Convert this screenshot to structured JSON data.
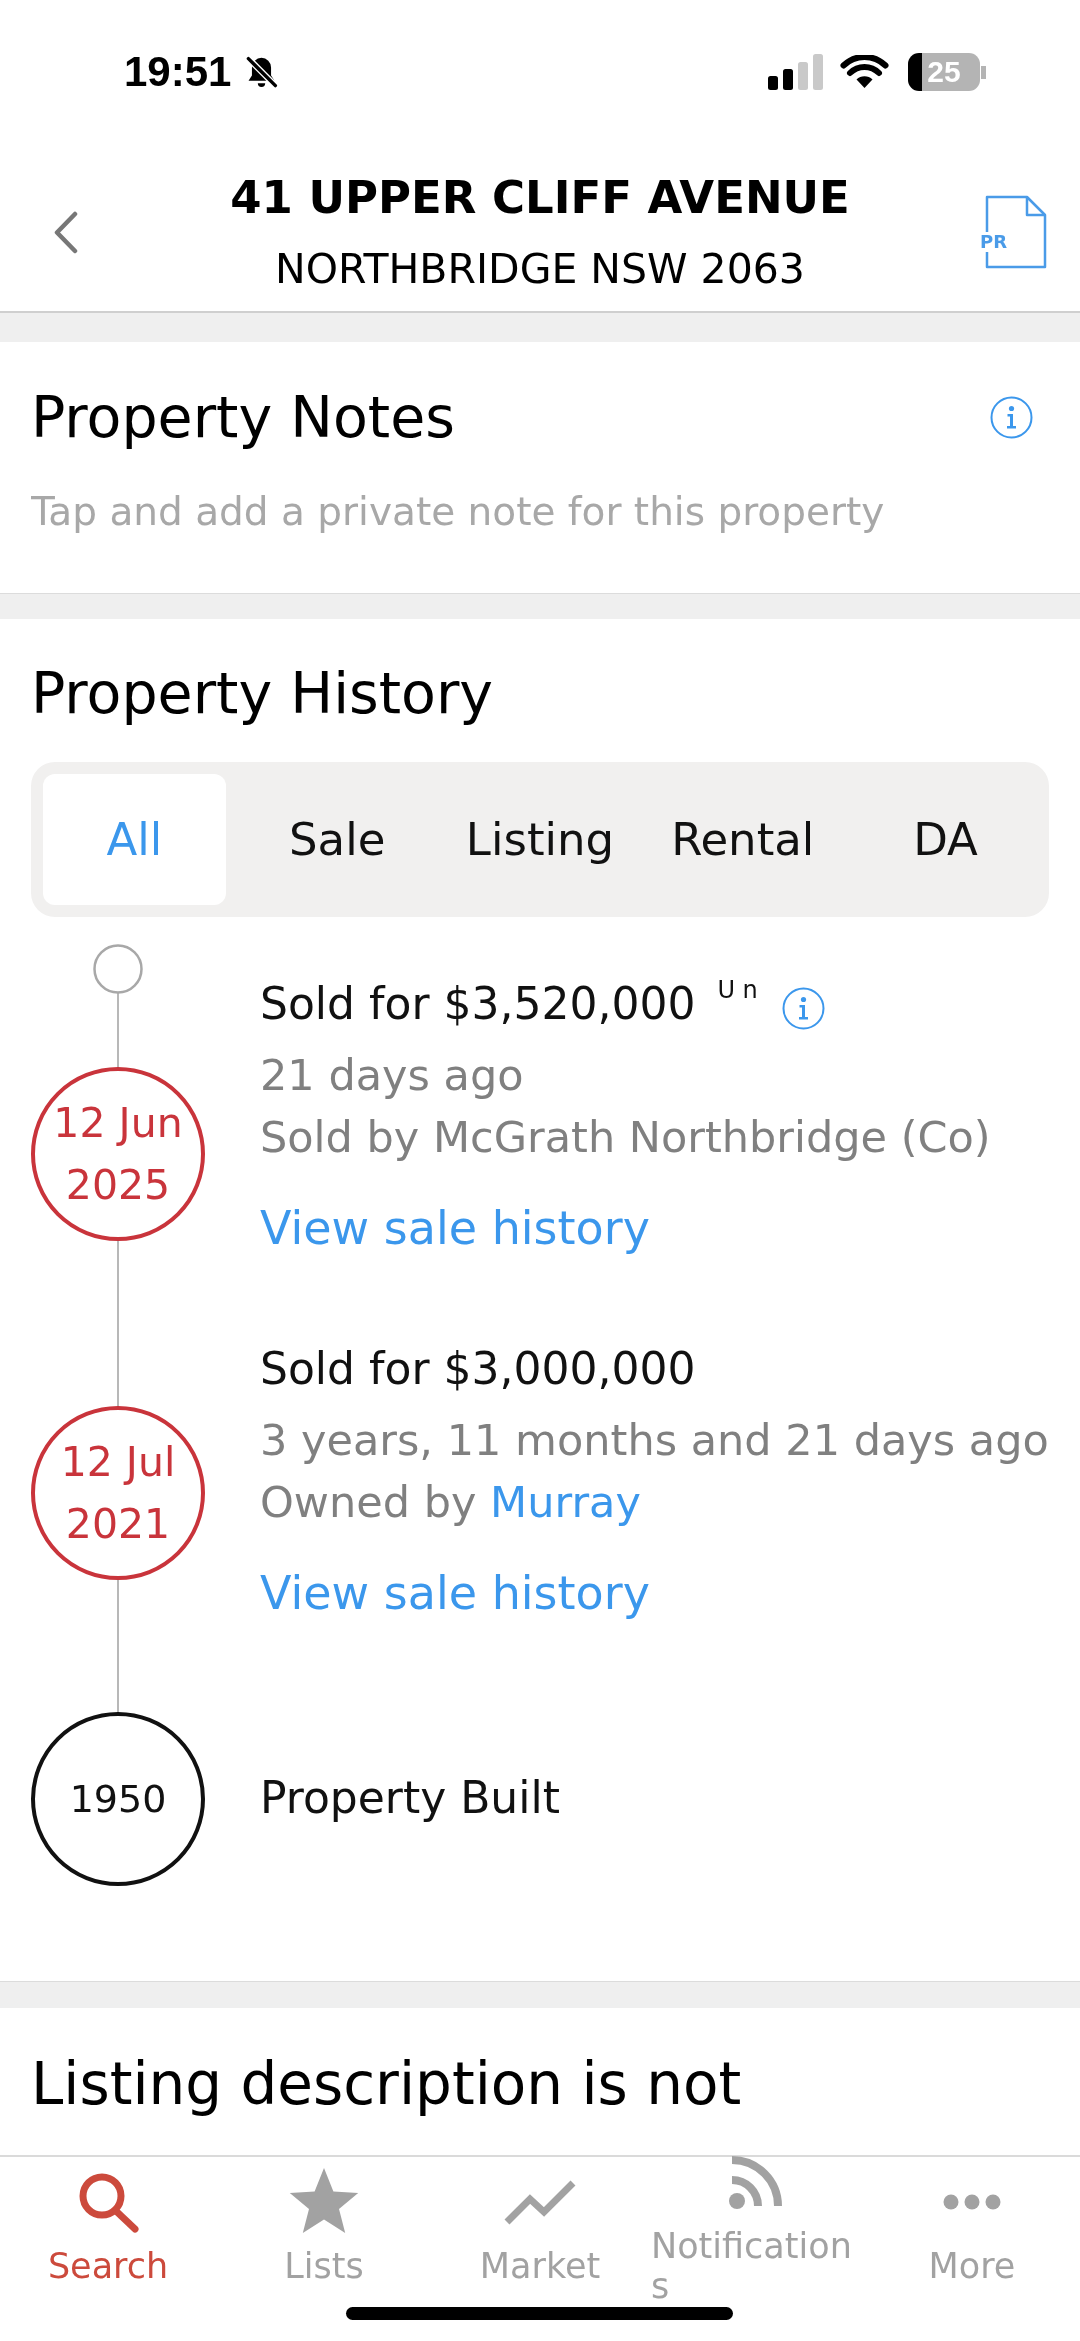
{
  "status_bar": {
    "time": "19:51",
    "battery": "25"
  },
  "header": {
    "title": "41 UPPER CLIFF AVENUE",
    "subtitle": "NORTHBRIDGE NSW 2063",
    "report_label": "PR"
  },
  "notes": {
    "title": "Property Notes",
    "placeholder": "Tap and add a private note for this property"
  },
  "history": {
    "title": "Property History",
    "tabs": [
      {
        "label": "All",
        "selected": true
      },
      {
        "label": "Sale",
        "selected": false
      },
      {
        "label": "Listing",
        "selected": false
      },
      {
        "label": "Rental",
        "selected": false
      },
      {
        "label": "DA",
        "selected": false
      }
    ],
    "events": [
      {
        "kind": "sale",
        "date": "12 Jun",
        "year": "2025",
        "title": "Sold for $3,520,000",
        "mark": "U n",
        "info": true,
        "ago": "21 days ago",
        "detail": "Sold by McGrath Northbridge (Co)",
        "link": "View sale history"
      },
      {
        "kind": "sale",
        "date": "12 Jul",
        "year": "2021",
        "title": "Sold for $3,000,000",
        "info": false,
        "ago": "3 years, 11 months and 21 days ago",
        "detail": "Owned by",
        "detail_link": "Murray",
        "link": "View sale history"
      },
      {
        "kind": "built",
        "date": "1950",
        "title": "Property Built",
        "info": false
      }
    ]
  },
  "listing_description": {
    "text": "Listing description is not"
  },
  "nav": [
    {
      "label": "Search",
      "selected": true
    },
    {
      "label": "Lists",
      "selected": false
    },
    {
      "label": "Market",
      "selected": false
    },
    {
      "label": "Notifications",
      "selected": false
    },
    {
      "label": "More",
      "selected": false
    }
  ]
}
